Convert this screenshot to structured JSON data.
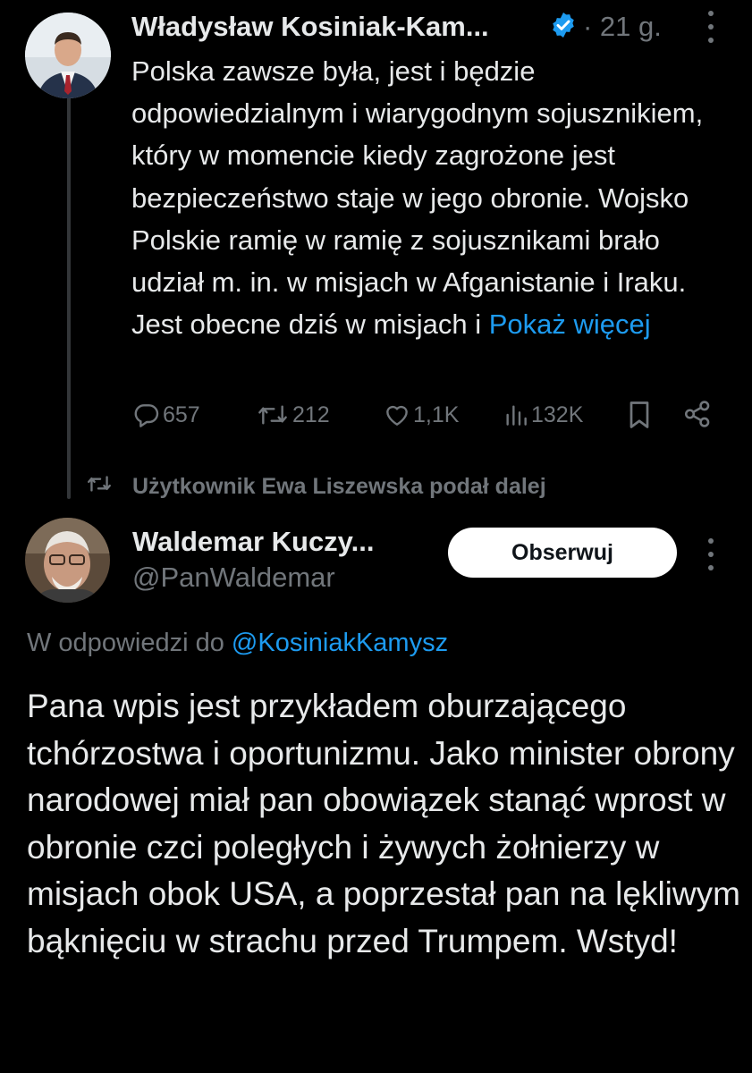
{
  "tweet1": {
    "author_name": "Władysław Kosiniak-Kam...",
    "time": "· 21 g.",
    "text": "Polska zawsze była, jest i będzie odpowiedzialnym i wiarygodnym sojusznikiem, który w momencie kiedy zagrożone jest bezpieczeństwo staje w jego obronie. Wojsko Polskie ramię w ramię z sojusznikami brało udział m. in. w misjach w Afganistanie i Iraku. Jest obecne dziś w misjach i",
    "show_more": "Pokaż więcej",
    "replies": "657",
    "retweets": "212",
    "likes": "1,1K",
    "views": "132K"
  },
  "retweeted_by": "Użytkownik Ewa Liszewska podał dalej",
  "tweet2": {
    "author_name": "Waldemar Kuczy...",
    "handle": "@PanWaldemar",
    "follow_label": "Obserwuj",
    "reply_prefix": "W odpowiedzi do",
    "reply_mention": "@KosiniakKamysz",
    "text": "Pana wpis jest przykładem oburzającego tchórzostwa i oportunizmu. Jako minister obrony narodowej miał pan obowiązek stanąć wprost w obronie czci poległych i żywych żołnierzy w misjach obok USA, a poprzestał pan na lękliwym bąknięciu w strachu przed Trumpem. Wstyd!"
  },
  "colors": {
    "background": "#000000",
    "text": "#e7e9ea",
    "muted": "#71767b",
    "accent": "#1d9bf0",
    "thread_line": "#333639"
  },
  "icons": [
    "verified-badge-icon",
    "more-options-icon",
    "reply-icon",
    "retweet-icon",
    "like-icon",
    "views-icon",
    "bookmark-icon",
    "share-icon"
  ]
}
